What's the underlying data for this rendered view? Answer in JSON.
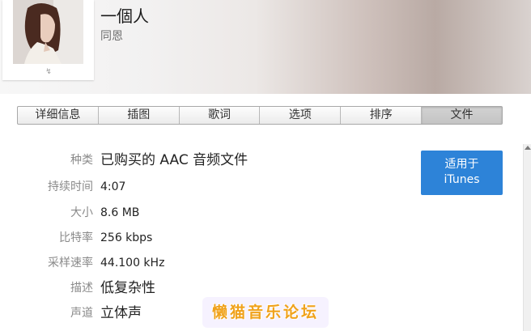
{
  "track": {
    "title": "一個人",
    "artist": "同恩",
    "art_caption": "↯"
  },
  "tabs": [
    {
      "label": "详细信息",
      "active": false
    },
    {
      "label": "插图",
      "active": false
    },
    {
      "label": "歌词",
      "active": false
    },
    {
      "label": "选项",
      "active": false
    },
    {
      "label": "排序",
      "active": false
    },
    {
      "label": "文件",
      "active": true
    }
  ],
  "file_info": {
    "kind_label": "种类",
    "kind_value": "已购买的 AAC 音频文件",
    "duration_label": "持续时间",
    "duration_value": "4:07",
    "size_label": "大小",
    "size_value": "8.6 MB",
    "bitrate_label": "比特率",
    "bitrate_value": "256 kbps",
    "samplerate_label": "采样速率",
    "samplerate_value": "44.100 kHz",
    "description_label": "描述",
    "description_value": "低复杂性",
    "channels_label": "声道",
    "channels_value": "立体声"
  },
  "itunes_button": {
    "line1": "适用于",
    "line2": "iTunes"
  },
  "watermark": {
    "text": "懒猫音乐论坛"
  },
  "colors": {
    "accent": "#2d83d8",
    "watermark": "#f0a21b"
  },
  "icons": {
    "scroll_up": "triangle-up"
  }
}
